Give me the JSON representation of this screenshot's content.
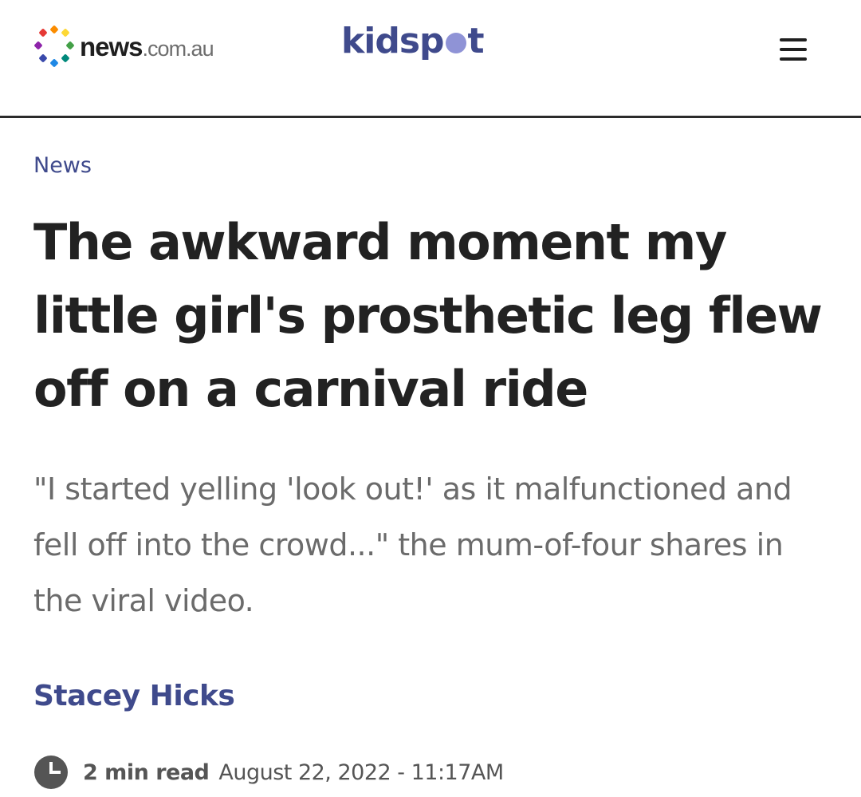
{
  "header": {
    "news_logo_bold": "news",
    "news_logo_light": ".com.au",
    "kidspot_logo_prefix": "kidsp",
    "kidspot_logo_suffix": "t",
    "menu_icon": "hamburger-menu-icon"
  },
  "article": {
    "category": "News",
    "headline": "The awkward moment my little girl's prosthetic leg flew off on a carnival ride",
    "standfirst": "\"I started yelling 'look out!' as it malfunctioned and fell off into the crowd...\" the mum-of-four shares in the viral video.",
    "author": "Stacey Hicks",
    "read_time": "2 min read",
    "published": "August 22, 2022 - 11:17AM"
  },
  "colors": {
    "brand_navy": "#3f4a8c",
    "kidspot_dot": "#8f93d6",
    "text_dark": "#222222",
    "text_grey": "#6b6b6b",
    "meta_grey": "#555555"
  }
}
